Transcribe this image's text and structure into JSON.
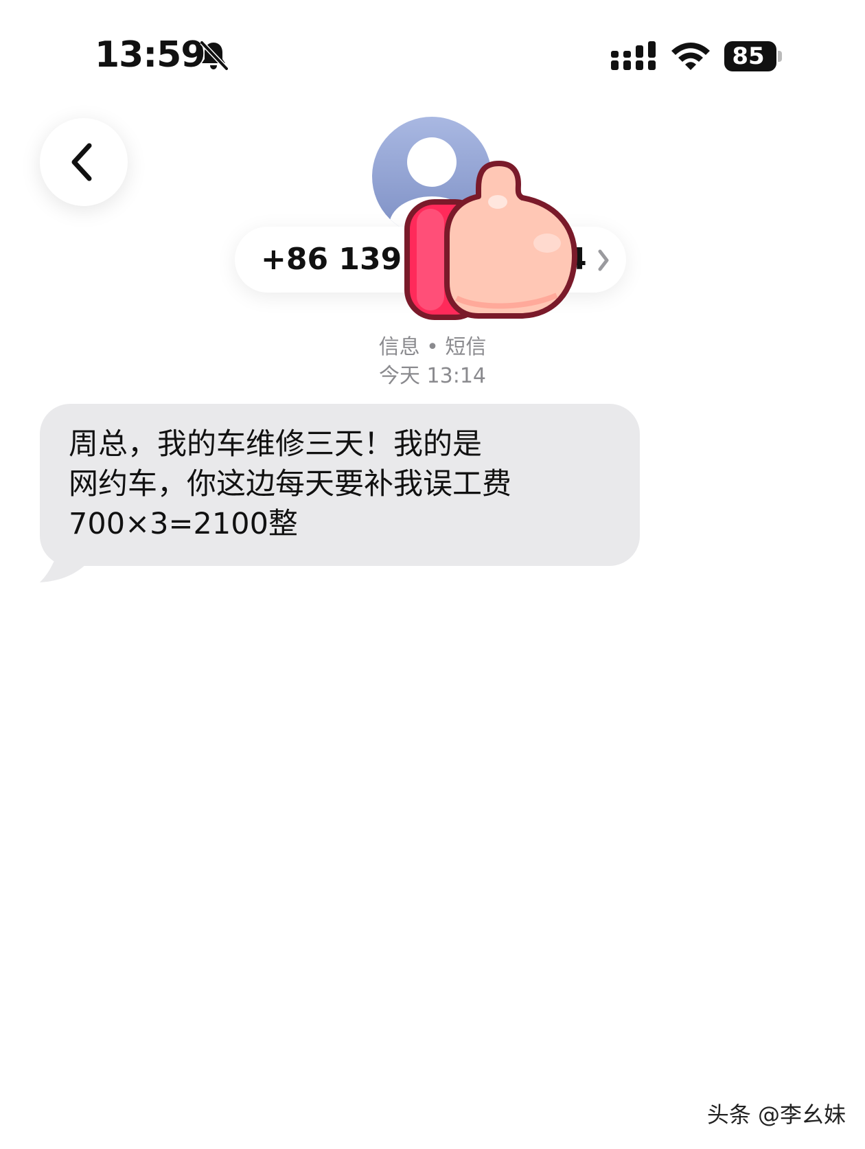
{
  "status_bar": {
    "time": "13:59",
    "battery": "85"
  },
  "icons": {
    "back": "chevron-left-icon",
    "bell": "bell-slash-icon",
    "signal": "cellular-signal-icon",
    "wifi": "wifi-icon",
    "avatar": "person-icon",
    "sticker": "thumbs-up-icon"
  },
  "header": {
    "contact_number": "+86 139",
    "contact_number_trail": "4"
  },
  "conversation": {
    "channel_label": "信息 • 短信",
    "timestamp": "今天 13:14"
  },
  "messages": [
    {
      "direction": "incoming",
      "text": "周总，我的车维修三天！我的是\n网约车，你这边每天要补我误工费\n700×3=2100整"
    }
  ],
  "watermark": {
    "text": "头条 @李幺妹"
  },
  "colors": {
    "incoming_bubble": "#e9e9eb",
    "meta_text": "#8a8a8e",
    "avatar": "#8d9dd0",
    "sticker_red": "#ff2a5a",
    "sticker_skin": "#ffc2b0"
  }
}
